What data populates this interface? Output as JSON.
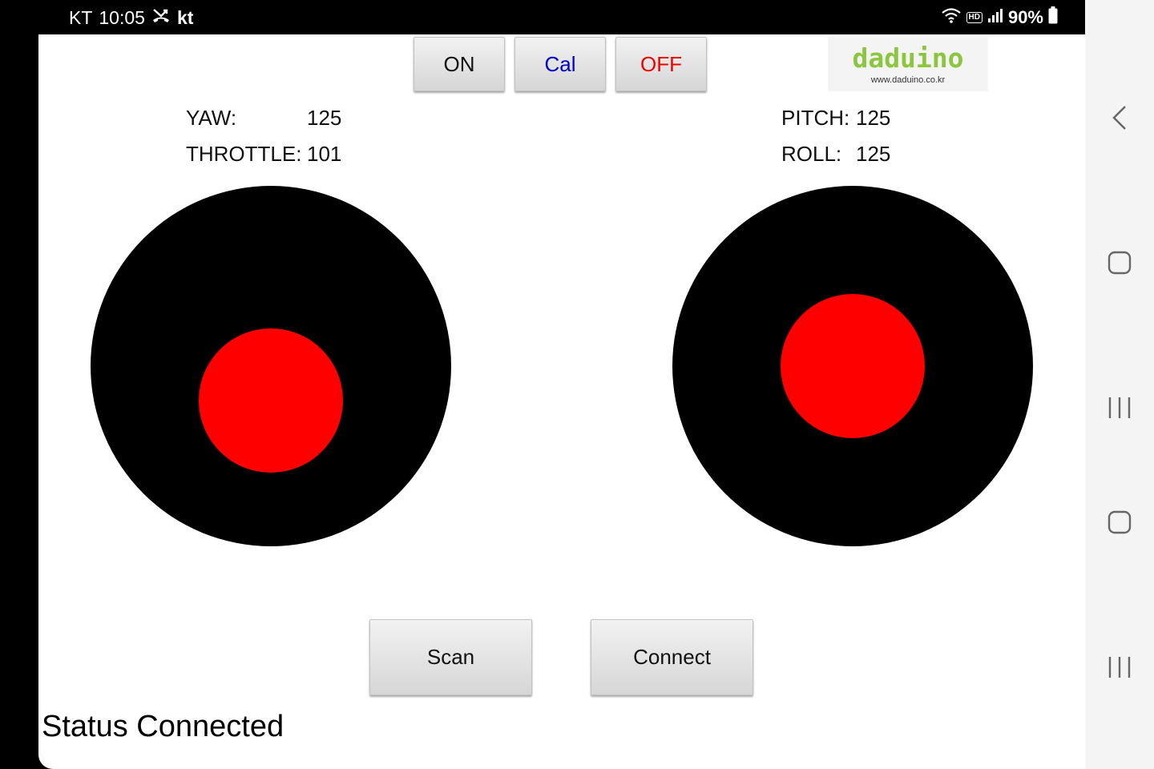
{
  "status_bar": {
    "carrier": "KT",
    "time": "10:05",
    "carrier_short": "kt",
    "hd_badge": "HD",
    "battery": "90%"
  },
  "controls": {
    "on_label": "ON",
    "cal_label": "Cal",
    "off_label": "OFF",
    "on_color": "#000000",
    "cal_color": "#0000cc",
    "off_color": "#ee0000"
  },
  "logo": {
    "word": "daduino",
    "url": "www.daduino.co.kr",
    "color": "#8cc63f"
  },
  "readouts": {
    "yaw_label": "YAW:",
    "yaw_value": "125",
    "throttle_label": "THROTTLE:",
    "throttle_value": "101",
    "pitch_label": "PITCH:",
    "pitch_value": "125",
    "roll_label": "ROLL:",
    "roll_value": "125"
  },
  "joysticks": {
    "base_color": "#000000",
    "knob_color": "#ff0000"
  },
  "actions": {
    "scan_label": "Scan",
    "connect_label": "Connect"
  },
  "status": {
    "text": "Status Connected"
  }
}
